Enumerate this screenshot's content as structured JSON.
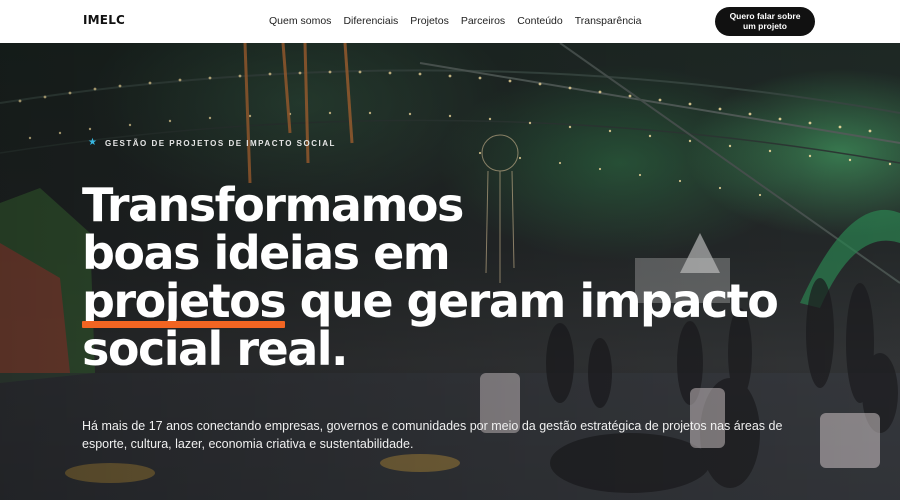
{
  "header": {
    "logo": "IMELC",
    "nav": [
      "Quem somos",
      "Diferenciais",
      "Projetos",
      "Parceiros",
      "Conteúdo",
      "Transparência"
    ],
    "cta_label": "Quero falar sobre um projeto"
  },
  "hero": {
    "eyebrow_icon": "star-icon",
    "eyebrow": "GESTÃO DE PROJETOS DE IMPACTO SOCIAL",
    "headline": {
      "line1": "Transformamos",
      "line2": "boas ideias em",
      "highlight": "projetos",
      "line3_rest": " que geram impacto",
      "line4": "social real."
    },
    "subtext": "Há mais de 17 anos conectando empresas, governos e comunidades por meio da gestão estratégica de projetos nas áreas de esporte, cultura, lazer, economia criativa e sustentabilidade."
  },
  "colors": {
    "accent": "#f26522",
    "eyebrow_star": "#38b6e0",
    "cta_bg": "#111111"
  }
}
